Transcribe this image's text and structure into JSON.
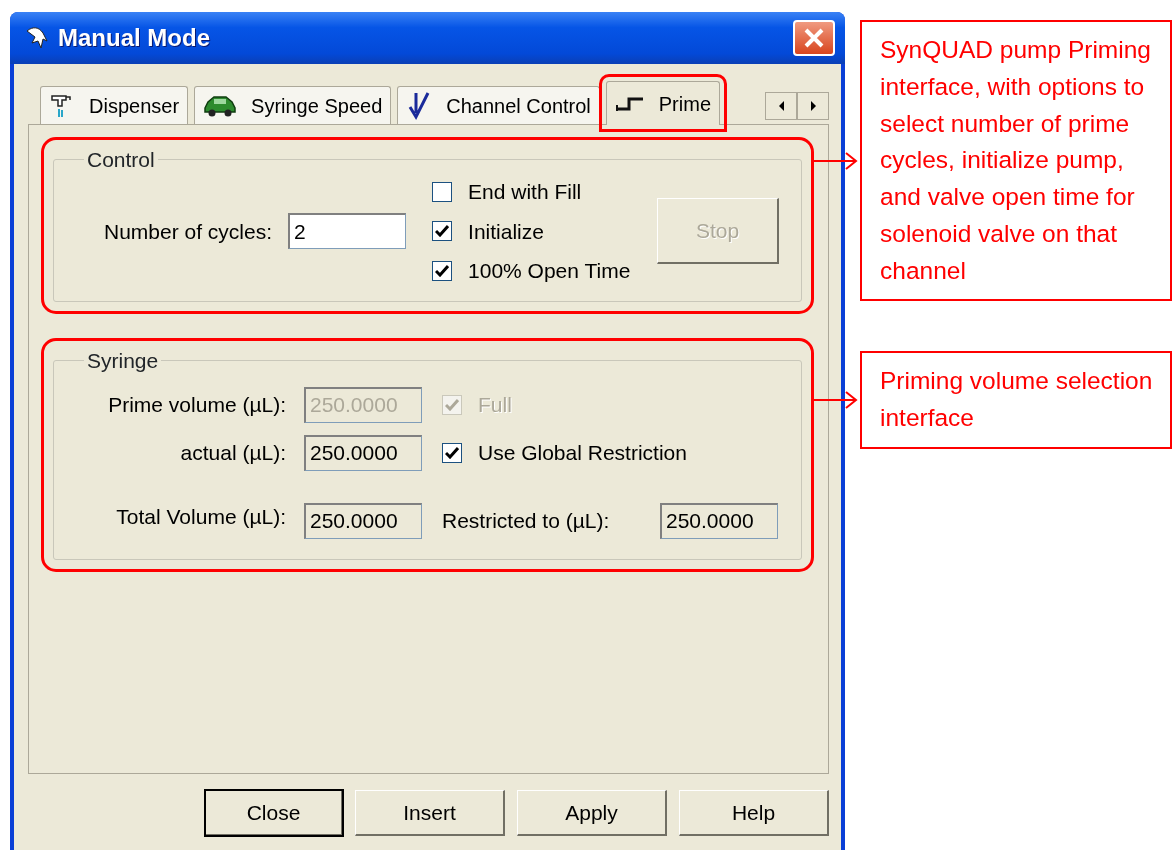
{
  "window": {
    "title": "Manual Mode"
  },
  "tabs": [
    {
      "label": "Dispenser",
      "kind": "tap",
      "selected": false,
      "highlighted": false
    },
    {
      "label": "Syringe Speed",
      "kind": "car",
      "selected": false,
      "highlighted": false
    },
    {
      "label": "Channel Control",
      "kind": "arrow",
      "selected": false,
      "highlighted": false
    },
    {
      "label": "Prime",
      "kind": "step",
      "selected": true,
      "highlighted": true
    }
  ],
  "control": {
    "title": "Control",
    "highlighted": true,
    "cycles_label": "Number of cycles:",
    "cycles_value": "2",
    "checkboxes": [
      {
        "label": "End with Fill",
        "checked": false
      },
      {
        "label": "Initialize",
        "checked": true
      },
      {
        "label": "100% Open Time",
        "checked": true
      }
    ],
    "stop_button": {
      "label": "Stop",
      "disabled": true
    }
  },
  "syringe": {
    "title": "Syringe",
    "highlighted": true,
    "rows": [
      {
        "label": "Prime volume (µL):",
        "value": "250.0000",
        "disabled": true,
        "kind": "checkbox",
        "check_label": "Full",
        "checked": true
      },
      {
        "label": "actual (µL):",
        "value": "250.0000",
        "disabled": false,
        "kind": "checkbox",
        "check_label": "Use Global Restriction",
        "checked": true
      },
      {
        "label": "Total Volume (µL):",
        "value": "250.0000",
        "disabled": false,
        "kind": "field",
        "field_label": "Restricted to (µL):",
        "field_value": "250.0000"
      }
    ]
  },
  "buttons": [
    {
      "label": "Close",
      "default": true
    },
    {
      "label": "Insert",
      "default": false
    },
    {
      "label": "Apply",
      "default": false
    },
    {
      "label": "Help",
      "default": false
    }
  ],
  "annotations": [
    {
      "text": "SynQUAD pump Priming interface, with options to select number of prime cycles, initialize pump, and valve open time for solenoid valve on that channel"
    },
    {
      "text": "Priming volume selection interface"
    }
  ]
}
